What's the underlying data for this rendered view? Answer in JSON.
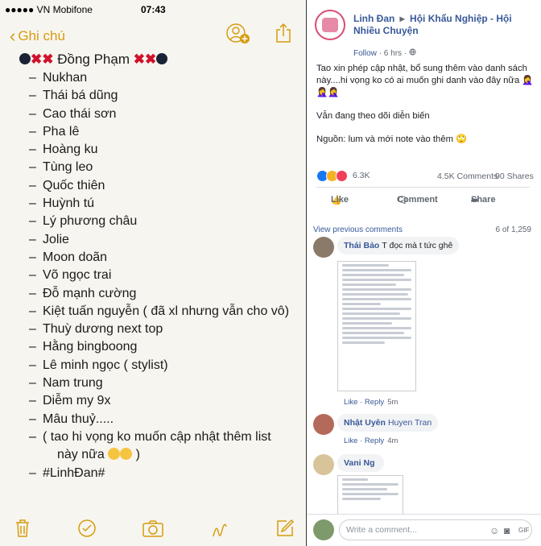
{
  "phone": {
    "carrier": "●●●●● VN Mobifone",
    "time": "07:43",
    "battery_text": "⊙ ✱"
  },
  "notes_nav": {
    "back_label": "Ghi chú"
  },
  "note": {
    "title": "Đồng Phạm",
    "items": [
      "Nukhan",
      "Thái bá dũng",
      "Cao thái sơn",
      "Pha lê",
      "Hoàng ku",
      "Tùng leo",
      "Quốc thiên",
      "Huỳnh tú",
      "Lý phương châu",
      "Jolie",
      "Moon doãn",
      "Võ ngọc trai",
      "Đỗ mạnh cường",
      "Kiệt tuấn nguyễn ( đã xl nhưng vẫn cho vô)",
      "Thuỳ dương next top",
      "Hằng bingboong",
      "Lê minh ngọc ( stylist)",
      "Nam trung",
      "Diễm my 9x",
      "Mâu thuỷ.....",
      ""
    ],
    "closing_line1": "(  tao hi vọng ko muốn cập nhật thêm list",
    "closing_line2": "này nữa",
    "closing_line2_end": ")",
    "signature": "#LinhĐan#"
  },
  "post": {
    "author": "Linh Đan",
    "arrow": "▸",
    "group": "Hội Khẩu Nghiệp - Hội Nhiều Chuyện",
    "follow": "Follow",
    "time": "· 6 hrs ·",
    "paragraph1": "Tao xin phép cập nhật, bổ sung thêm vào danh sách này....hi vọng ko có ai muốn ghi danh vào đây nữa 🤦‍♀️🤦‍♀️🤦‍♀️",
    "paragraph2": "Vẫn đang theo dõi diễn biến",
    "paragraph3": "Nguồn: lum và mới note vào thêm 🙄",
    "reactions_count": "6.3K",
    "comments_count": "4.5K Comments",
    "shares_count": "90 Shares",
    "like_label": "Like",
    "comment_label": "Comment",
    "share_label": "Share"
  },
  "comments": {
    "view_previous": "View previous comments",
    "count": "6 of 1,259",
    "list": [
      {
        "name": "Thái Bảo",
        "text": "T đọc mà t tức ghê",
        "like": "Like",
        "reply": "Reply",
        "time": "5m"
      },
      {
        "name": "Nhật Uyên",
        "text": "Huyen Tran",
        "like": "Like",
        "reply": "Reply",
        "time": "4m"
      },
      {
        "name": "Vani Ng",
        "text": "",
        "like": "",
        "reply": "",
        "time": ""
      }
    ],
    "placeholder": "Write a comment..."
  },
  "colors": {
    "ios_accent": "#d69c11",
    "fb_link": "#385898"
  }
}
